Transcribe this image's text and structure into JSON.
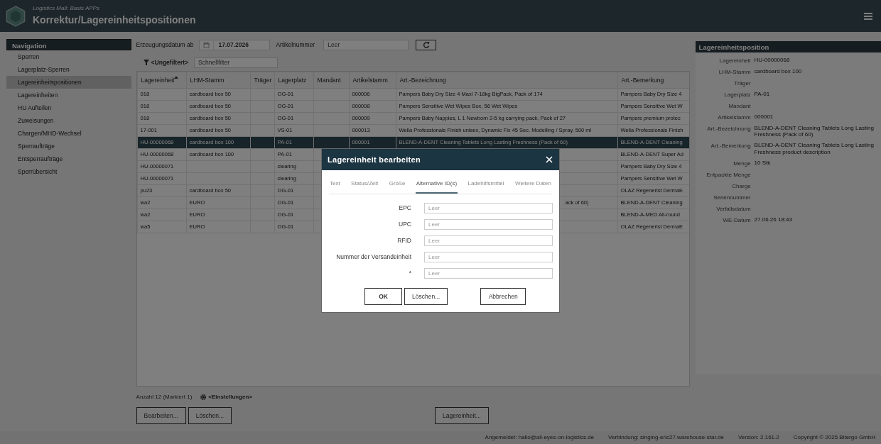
{
  "app": {
    "subtitle": "Logistics Mall: Basis APPs",
    "title": "Korrektur/Lagereinheitspositionen"
  },
  "navigation": {
    "title": "Navigation",
    "items": [
      {
        "label": "Sperren",
        "selected": false
      },
      {
        "label": "Lagerplatz-Sperren",
        "selected": false
      },
      {
        "label": "Lagereinheitspositionen",
        "selected": true
      },
      {
        "label": "Lagereinheiten",
        "selected": false
      },
      {
        "label": "HU Aufteilen",
        "selected": false
      },
      {
        "label": "Zuweisungen",
        "selected": false
      },
      {
        "label": "Chargen/MHD-Wechsel",
        "selected": false
      },
      {
        "label": "Sperraufträge",
        "selected": false
      },
      {
        "label": "Entsperraufträge",
        "selected": false
      },
      {
        "label": "Sperrübersicht",
        "selected": false
      }
    ]
  },
  "filters": {
    "date": {
      "label": "Erzeugungsdatum ab",
      "value": "17.07.2026"
    },
    "article": {
      "label": "Artikelnummer",
      "placeholder": "Leer"
    }
  },
  "quick_filter": {
    "label": "<Ungefiltert>",
    "placeholder": "Schnellfilter"
  },
  "table": {
    "columns": [
      {
        "label": "Lagereinheit",
        "sorted": true
      },
      {
        "label": "LHM-Stamm",
        "sorted": false
      },
      {
        "label": "Träger",
        "sorted": false
      },
      {
        "label": "Lagerplatz",
        "sorted": false
      },
      {
        "label": "Mandant",
        "sorted": false
      },
      {
        "label": "Artikelstamm",
        "sorted": false
      },
      {
        "label": "Art.-Bezeichnung",
        "sorted": false
      },
      {
        "label": "Art.-Bemerkung",
        "sorted": false
      }
    ],
    "rows": [
      {
        "selected": false,
        "lagereinheit": "018",
        "lhm_stamm": "cardboard box 50",
        "lagerplatz": "OG-01",
        "artikelstamm": "000006",
        "art_bezeichnung": "Pampers Baby Dry Size 4 Maxi 7-18kg BigPack, Pack of 174",
        "art_bemerkung": "Pampers Baby Dry Size 4"
      },
      {
        "selected": false,
        "lagereinheit": "018",
        "lhm_stamm": "cardboard box 50",
        "lagerplatz": "OG-01",
        "artikelstamm": "000008",
        "art_bezeichnung": "Pampers Sensitive Wet Wipes Box, 56 Wet Wipes",
        "art_bemerkung": "Pampers Sensitive Wet W"
      },
      {
        "selected": false,
        "lagereinheit": "018",
        "lhm_stamm": "cardboard box 50",
        "lagerplatz": "OG-01",
        "artikelstamm": "000009",
        "art_bezeichnung": "Pampers Baby Nappies, L 1 Newborn 2-5 kg carrying pack, Pack of 27",
        "art_bemerkung": "Pampers premium protec"
      },
      {
        "selected": false,
        "lagereinheit": "17-001",
        "lhm_stamm": "cardboard box 50",
        "lagerplatz": "VS-01",
        "artikelstamm": "000013",
        "art_bezeichnung": "Wella Professionals Finish unisex, Dynamic Fix 45 Sec. Modelling / Spray, 500 ml",
        "art_bemerkung": "Wella Professionals Finish"
      },
      {
        "selected": true,
        "lagereinheit": "HU-00000068",
        "lhm_stamm": "cardboard box 100",
        "lagerplatz": "PA-01",
        "artikelstamm": "000001",
        "art_bezeichnung": "BLEND-A-DENT Cleaning Tablets Long Lasting Freshness (Pack of 60)",
        "art_bemerkung": "BLEND-A-DENT Cleaning"
      },
      {
        "selected": false,
        "lagereinheit": "HU-00000068",
        "lhm_stamm": "cardboard box 100",
        "lagerplatz": "PA-01",
        "art_bemerkung": "BLEND-A-DENT Super Ad"
      },
      {
        "selected": false,
        "lagereinheit": "HU-00000071",
        "lagerplatz": "clearing",
        "art_bemerkung": "Pampers Baby Dry Size 4"
      },
      {
        "selected": false,
        "lagereinheit": "HU-00000071",
        "lagerplatz": "clearing",
        "art_bemerkung": "Pampers Sensitive Wet W"
      },
      {
        "selected": false,
        "lagereinheit": "pu23",
        "lhm_stamm": "cardboard box 50",
        "lagerplatz": "OG-01",
        "art_bemerkung": "OLAZ Regenerist DermaE"
      },
      {
        "selected": false,
        "lagereinheit": "wa2",
        "lhm_stamm": "EURO",
        "lagerplatz": "OG-01",
        "art_bezeichnung_tail": "ack of 60)",
        "art_bemerkung": "BLEND-A-DENT Cleaning"
      },
      {
        "selected": false,
        "lagereinheit": "wa2",
        "lhm_stamm": "EURO",
        "lagerplatz": "OG-01",
        "art_bemerkung": "BLEND-A-MED All-round"
      },
      {
        "selected": false,
        "lagereinheit": "wa5",
        "lhm_stamm": "EURO",
        "lagerplatz": "OG-01",
        "art_bemerkung": "OLAZ Regenerist DermaE"
      }
    ]
  },
  "summary": {
    "count": "Anzahl 12 (Markiert 1)",
    "settings": "<Einstellungen>"
  },
  "actions": {
    "left": [
      "Bearbeiten...",
      "Löschen..."
    ],
    "right": [
      "Lagereinheit..."
    ]
  },
  "detail": {
    "title": "Lagereinheitsposition",
    "fields": [
      {
        "label": "Lagereinheit",
        "value": "HU-00000068"
      },
      {
        "label": "LHM-Stamm",
        "value": "cardboard box 100"
      },
      {
        "label": "Träger"
      },
      {
        "label": "Lagerplatz",
        "value": "PA-01"
      },
      {
        "label": "Mandant"
      },
      {
        "label": "Artikelstamm",
        "value": "000001"
      },
      {
        "label": "Art.-Bezeichnung",
        "value": "BLEND-A-DENT Cleaning Tablets Long Lasting Freshness (Pack of 60)"
      },
      {
        "label": "Art.-Bemerkung",
        "value": "BLEND-A-DENT Cleaning Tablets Long Lasting Freshness product description"
      },
      {
        "label": "Menge",
        "value": "10 Stk"
      },
      {
        "label": "Entpackte Menge"
      },
      {
        "label": "Charge"
      },
      {
        "label": "Seriennummer"
      },
      {
        "label": "Verfallsdatum"
      },
      {
        "label": "WE-Datum",
        "value": "27.06.26 18:43"
      }
    ]
  },
  "dialog": {
    "title": "Lagereinheit bearbeiten",
    "tabs": [
      {
        "label": "Text",
        "selected": false
      },
      {
        "label": "Status/Zeit",
        "selected": false
      },
      {
        "label": "Größe",
        "selected": false
      },
      {
        "label": "Alternative ID(s)",
        "selected": true
      },
      {
        "label": "Ladehilfsmittel",
        "selected": false
      },
      {
        "label": "Weitere Daten",
        "selected": false
      }
    ],
    "fields": [
      {
        "label": "EPC",
        "placeholder": "Leer"
      },
      {
        "label": "UPC",
        "placeholder": "Leer"
      },
      {
        "label": "RFID",
        "placeholder": "Leer"
      },
      {
        "label": "Nummer der Versandeinheit",
        "placeholder": "Leer"
      },
      {
        "label": "*",
        "placeholder": "Leer"
      }
    ],
    "buttons": [
      {
        "label": "OK",
        "kind": "default"
      },
      {
        "label": "Löschen...",
        "kind": "action"
      },
      {
        "label": "Abbrechen",
        "kind": "cancel"
      }
    ]
  },
  "footer": {
    "user": "Angemeldet: hallo@all-eyes-on-logistics.de",
    "connection": "Verbindung: singing-eric27.warehouse-star.de",
    "version": "Version: 2.161.2",
    "copyright": "Copyright © 2025 Bitergo GmbH"
  }
}
